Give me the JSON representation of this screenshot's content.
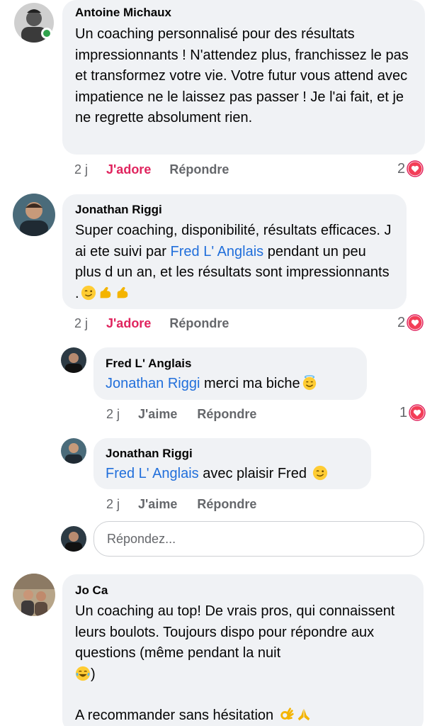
{
  "comments": [
    {
      "author": "Antoine Michaux",
      "text": "Un coaching personnalisé pour des résultats impressionnants ! N'attendez plus, franchissez le pas et transformez votre vie. Votre futur vous attend avec impatience ne le laissez pas passer ! Je l'ai fait, et je ne regrette absolument rien.",
      "time": "2 j",
      "react_label": "J'adore",
      "reply_label": "Répondre",
      "reaction_count": "2"
    },
    {
      "author": "Jonathan Riggi",
      "text_before": "Super coaching, disponibilité, résultats efficaces. J ai ete suivi par ",
      "mention": "Fred L' Anglais",
      "text_after": " pendant un peu plus d un an, et les résultats sont impressionnants .",
      "time": "2 j",
      "react_label": "J'adore",
      "reply_label": "Répondre",
      "reaction_count": "2",
      "replies": [
        {
          "author": "Fred L' Anglais",
          "mention": "Jonathan Riggi",
          "text": " merci ma biche",
          "time": "2 j",
          "like_label": "J'aime",
          "reply_label": "Répondre",
          "reaction_count": "1"
        },
        {
          "author": "Jonathan Riggi",
          "mention": "Fred L' Anglais",
          "text": " avec plaisir Fred",
          "time": "2 j",
          "like_label": "J'aime",
          "reply_label": "Répondre"
        }
      ],
      "reply_box_placeholder": "Répondez..."
    },
    {
      "author": "Jo Ca",
      "text_line1": "Un coaching au top! De vrais pros, qui connaissent leurs boulots. Toujours dispo pour répondre aux questions (même pendant la nuit",
      "text_line1_end": ")",
      "text_line2": "A recommander sans hésitation"
    }
  ],
  "colors": {
    "bubble": "#f0f2f5",
    "mention": "#216fdb",
    "love": "#e0245e",
    "meta": "#65676b",
    "online": "#31a24c"
  },
  "icons": [
    "heart-reaction-icon",
    "wink-emoji",
    "flexed-biceps-emoji",
    "smiling-halo-emoji",
    "tears-of-joy-emoji",
    "ok-hand-emoji",
    "folded-hands-emoji"
  ]
}
